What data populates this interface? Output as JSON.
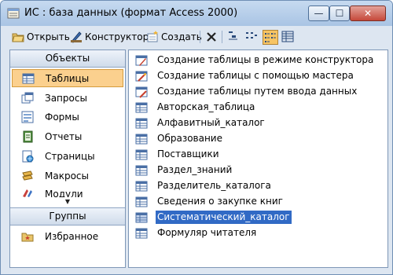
{
  "window": {
    "title": "ИС : база данных (формат Access 2000)",
    "controls": {
      "minimize": "—",
      "maximize": "☐",
      "close": "✕"
    }
  },
  "toolbar": {
    "open_label": "Открыть",
    "design_label": "Конструктор",
    "create_label": "Создать"
  },
  "objects_panel": {
    "header": "Объекты",
    "items": [
      {
        "label": "Таблицы",
        "icon": "table-icon",
        "selected": true
      },
      {
        "label": "Запросы",
        "icon": "query-icon"
      },
      {
        "label": "Формы",
        "icon": "form-icon"
      },
      {
        "label": "Отчеты",
        "icon": "report-icon"
      },
      {
        "label": "Страницы",
        "icon": "page-icon"
      },
      {
        "label": "Макросы",
        "icon": "macro-icon"
      },
      {
        "label": "Модули",
        "icon": "module-icon"
      }
    ],
    "groups_header": "Группы",
    "groups": [
      {
        "label": "Избранное",
        "icon": "favorites-icon"
      }
    ]
  },
  "list": {
    "items": [
      {
        "label": "Создание таблицы в режиме конструктора",
        "icon": "create-shortcut-icon"
      },
      {
        "label": "Создание таблицы с помощью мастера",
        "icon": "wizard-shortcut-icon"
      },
      {
        "label": "Создание таблицы путем ввода данных",
        "icon": "datasheet-shortcut-icon"
      },
      {
        "label": "Авторская_таблица",
        "icon": "table-icon"
      },
      {
        "label": "Алфавитный_каталог",
        "icon": "table-icon"
      },
      {
        "label": "Образование",
        "icon": "table-icon"
      },
      {
        "label": "Поставщики",
        "icon": "table-icon"
      },
      {
        "label": "Раздел_знаний",
        "icon": "table-icon"
      },
      {
        "label": "Разделитель_каталога",
        "icon": "table-icon"
      },
      {
        "label": "Сведения о закупке книг",
        "icon": "table-icon"
      },
      {
        "label": "Систематический_каталог",
        "icon": "table-icon",
        "selected": true
      },
      {
        "label": "Формуляр читателя",
        "icon": "table-icon"
      }
    ]
  },
  "colors": {
    "selection": "#316ac5",
    "nav_selected": "#fbd08e",
    "window_frame": "#dde6f1"
  }
}
